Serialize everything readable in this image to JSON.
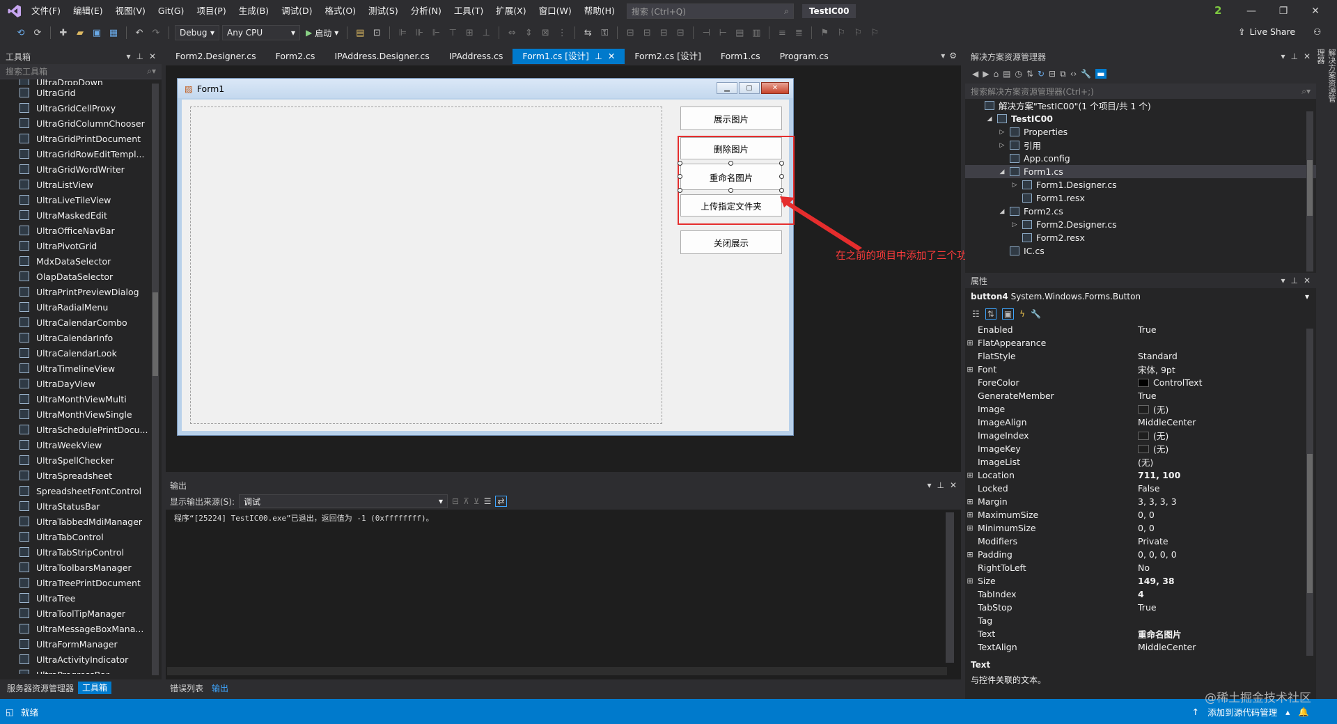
{
  "menu": [
    "文件(F)",
    "编辑(E)",
    "视图(V)",
    "Git(G)",
    "项目(P)",
    "生成(B)",
    "调试(D)",
    "格式(O)",
    "测试(S)",
    "分析(N)",
    "工具(T)",
    "扩展(X)",
    "窗口(W)",
    "帮助(H)"
  ],
  "search_placeholder": "搜索 (Ctrl+Q)",
  "project_title": "TestIC00",
  "notification_count": "2",
  "toolbar": {
    "config": "Debug",
    "platform": "Any CPU",
    "start_label": "启动",
    "live_share": "Live Share"
  },
  "toolbox": {
    "title": "工具箱",
    "search_placeholder": "搜索工具箱",
    "items": [
      "UltraDropDown",
      "UltraGrid",
      "UltraGridCellProxy",
      "UltraGridColumnChooser",
      "UltraGridPrintDocument",
      "UltraGridRowEditTempl...",
      "UltraGridWordWriter",
      "UltraListView",
      "UltraLiveTileView",
      "UltraMaskedEdit",
      "UltraOfficeNavBar",
      "UltraPivotGrid",
      "MdxDataSelector",
      "OlapDataSelector",
      "UltraPrintPreviewDialog",
      "UltraRadialMenu",
      "UltraCalendarCombo",
      "UltraCalendarInfo",
      "UltraCalendarLook",
      "UltraTimelineView",
      "UltraDayView",
      "UltraMonthViewMulti",
      "UltraMonthViewSingle",
      "UltraSchedulePrintDocu...",
      "UltraWeekView",
      "UltraSpellChecker",
      "UltraSpreadsheet",
      "SpreadsheetFontControl",
      "UltraStatusBar",
      "UltraTabbedMdiManager",
      "UltraTabControl",
      "UltraTabStripControl",
      "UltraToolbarsManager",
      "UltraTreePrintDocument",
      "UltraTree",
      "UltraToolTipManager",
      "UltraMessageBoxMana...",
      "UltraFormManager",
      "UltraActivityIndicator",
      "UltraProgressBar"
    ],
    "bottom_tabs": [
      "服务器资源管理器",
      "工具箱"
    ]
  },
  "doc_tabs": [
    "Form2.Designer.cs",
    "Form2.cs",
    "IPAddress.Designer.cs",
    "IPAddress.cs",
    "Form1.cs [设计]",
    "Form2.cs [设计]",
    "Form1.cs",
    "Program.cs"
  ],
  "form": {
    "title": "Form1",
    "buttons": [
      "展示图片",
      "删除图片",
      "重命名图片",
      "上传指定文件夹",
      "关闭展示"
    ],
    "annotation": "在之前的项目中添加了三个功能"
  },
  "output": {
    "title": "输出",
    "source_label": "显示输出来源(S):",
    "source_value": "调试",
    "text": "程序“[25224] TestIC00.exe”已退出，返回值为 -1 (0xffffffff)。",
    "bottom_tabs": [
      "错误列表",
      "输出"
    ]
  },
  "solution": {
    "title": "解决方案资源管理器",
    "search_placeholder": "搜索解决方案资源管理器(Ctrl+;)",
    "tree": [
      {
        "label": "解决方案\"TestIC00\"(1 个项目/共 1 个)",
        "indent": 0,
        "arrow": ""
      },
      {
        "label": "TestIC00",
        "indent": 1,
        "arrow": "◢"
      },
      {
        "label": "Properties",
        "indent": 2,
        "arrow": "▷"
      },
      {
        "label": "引用",
        "indent": 2,
        "arrow": "▷"
      },
      {
        "label": "App.config",
        "indent": 2,
        "arrow": ""
      },
      {
        "label": "Form1.cs",
        "indent": 2,
        "arrow": "◢"
      },
      {
        "label": "Form1.Designer.cs",
        "indent": 3,
        "arrow": "▷"
      },
      {
        "label": "Form1.resx",
        "indent": 3,
        "arrow": ""
      },
      {
        "label": "Form2.cs",
        "indent": 2,
        "arrow": "◢"
      },
      {
        "label": "Form2.Designer.cs",
        "indent": 3,
        "arrow": "▷"
      },
      {
        "label": "Form2.resx",
        "indent": 3,
        "arrow": ""
      },
      {
        "label": "IC.cs",
        "indent": 2,
        "arrow": ""
      }
    ]
  },
  "properties": {
    "title": "属性",
    "object_name": "button4",
    "object_type": "System.Windows.Forms.Button",
    "rows": [
      {
        "name": "Enabled",
        "value": "True",
        "exp": "",
        "bold": false,
        "swatch": ""
      },
      {
        "name": "FlatAppearance",
        "value": "",
        "exp": "⊞",
        "bold": false,
        "swatch": ""
      },
      {
        "name": "FlatStyle",
        "value": "Standard",
        "exp": "",
        "bold": false,
        "swatch": ""
      },
      {
        "name": "Font",
        "value": "宋体, 9pt",
        "exp": "⊞",
        "bold": false,
        "swatch": ""
      },
      {
        "name": "ForeColor",
        "value": "ControlText",
        "exp": "",
        "bold": false,
        "swatch": "black"
      },
      {
        "name": "GenerateMember",
        "value": "True",
        "exp": "",
        "bold": false,
        "swatch": ""
      },
      {
        "name": "Image",
        "value": "(无)",
        "exp": "",
        "bold": false,
        "swatch": "empty"
      },
      {
        "name": "ImageAlign",
        "value": "MiddleCenter",
        "exp": "",
        "bold": false,
        "swatch": ""
      },
      {
        "name": "ImageIndex",
        "value": "(无)",
        "exp": "",
        "bold": false,
        "swatch": "empty"
      },
      {
        "name": "ImageKey",
        "value": "(无)",
        "exp": "",
        "bold": false,
        "swatch": "empty"
      },
      {
        "name": "ImageList",
        "value": "(无)",
        "exp": "",
        "bold": false,
        "swatch": ""
      },
      {
        "name": "Location",
        "value": "711, 100",
        "exp": "⊞",
        "bold": true,
        "swatch": ""
      },
      {
        "name": "Locked",
        "value": "False",
        "exp": "",
        "bold": false,
        "swatch": ""
      },
      {
        "name": "Margin",
        "value": "3, 3, 3, 3",
        "exp": "⊞",
        "bold": false,
        "swatch": ""
      },
      {
        "name": "MaximumSize",
        "value": "0, 0",
        "exp": "⊞",
        "bold": false,
        "swatch": ""
      },
      {
        "name": "MinimumSize",
        "value": "0, 0",
        "exp": "⊞",
        "bold": false,
        "swatch": ""
      },
      {
        "name": "Modifiers",
        "value": "Private",
        "exp": "",
        "bold": false,
        "swatch": ""
      },
      {
        "name": "Padding",
        "value": "0, 0, 0, 0",
        "exp": "⊞",
        "bold": false,
        "swatch": ""
      },
      {
        "name": "RightToLeft",
        "value": "No",
        "exp": "",
        "bold": false,
        "swatch": ""
      },
      {
        "name": "Size",
        "value": "149, 38",
        "exp": "⊞",
        "bold": true,
        "swatch": ""
      },
      {
        "name": "TabIndex",
        "value": "4",
        "exp": "",
        "bold": true,
        "swatch": ""
      },
      {
        "name": "TabStop",
        "value": "True",
        "exp": "",
        "bold": false,
        "swatch": ""
      },
      {
        "name": "Tag",
        "value": "",
        "exp": "",
        "bold": false,
        "swatch": ""
      },
      {
        "name": "Text",
        "value": "重命名图片",
        "exp": "",
        "bold": true,
        "swatch": ""
      },
      {
        "name": "TextAlign",
        "value": "MiddleCenter",
        "exp": "",
        "bold": false,
        "swatch": ""
      }
    ],
    "desc_title": "Text",
    "desc_text": "与控件关联的文本。"
  },
  "side_strip": "解决方案资源管理器",
  "status": {
    "left": "就绪",
    "right": "添加到源代码管理",
    "watermark": "@稀土掘金技术社区"
  }
}
